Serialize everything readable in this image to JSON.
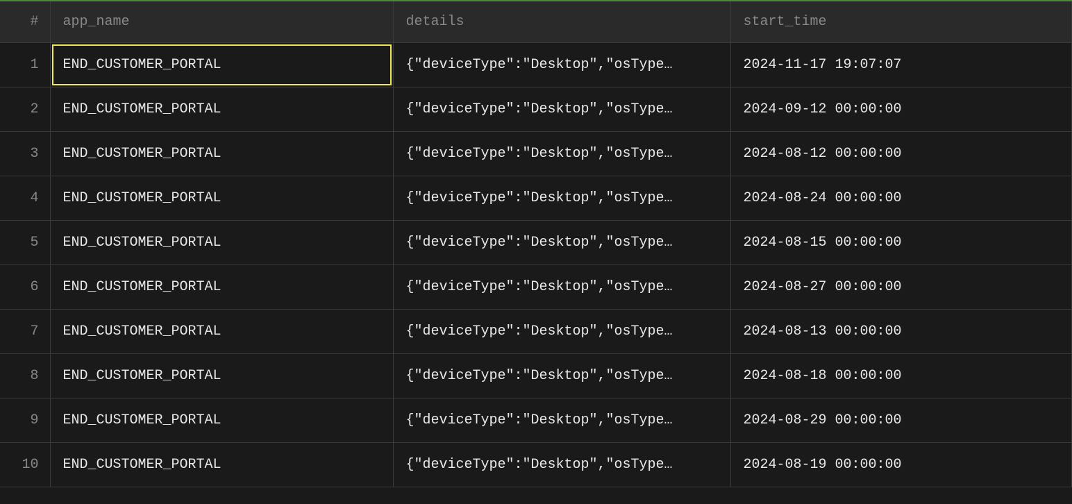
{
  "table": {
    "columns": {
      "index": "#",
      "app_name": "app_name",
      "details": "details",
      "start_time": "start_time"
    },
    "selected_cell": {
      "row": 0,
      "col": "app_name"
    },
    "rows": [
      {
        "index": "1",
        "app_name": "END_CUSTOMER_PORTAL",
        "details": "{\"deviceType\":\"Desktop\",\"osType…",
        "start_time": "2024-11-17 19:07:07"
      },
      {
        "index": "2",
        "app_name": "END_CUSTOMER_PORTAL",
        "details": "{\"deviceType\":\"Desktop\",\"osType…",
        "start_time": "2024-09-12 00:00:00"
      },
      {
        "index": "3",
        "app_name": "END_CUSTOMER_PORTAL",
        "details": "{\"deviceType\":\"Desktop\",\"osType…",
        "start_time": "2024-08-12 00:00:00"
      },
      {
        "index": "4",
        "app_name": "END_CUSTOMER_PORTAL",
        "details": "{\"deviceType\":\"Desktop\",\"osType…",
        "start_time": "2024-08-24 00:00:00"
      },
      {
        "index": "5",
        "app_name": "END_CUSTOMER_PORTAL",
        "details": "{\"deviceType\":\"Desktop\",\"osType…",
        "start_time": "2024-08-15 00:00:00"
      },
      {
        "index": "6",
        "app_name": "END_CUSTOMER_PORTAL",
        "details": "{\"deviceType\":\"Desktop\",\"osType…",
        "start_time": "2024-08-27 00:00:00"
      },
      {
        "index": "7",
        "app_name": "END_CUSTOMER_PORTAL",
        "details": "{\"deviceType\":\"Desktop\",\"osType…",
        "start_time": "2024-08-13 00:00:00"
      },
      {
        "index": "8",
        "app_name": "END_CUSTOMER_PORTAL",
        "details": "{\"deviceType\":\"Desktop\",\"osType…",
        "start_time": "2024-08-18 00:00:00"
      },
      {
        "index": "9",
        "app_name": "END_CUSTOMER_PORTAL",
        "details": "{\"deviceType\":\"Desktop\",\"osType…",
        "start_time": "2024-08-29 00:00:00"
      },
      {
        "index": "10",
        "app_name": "END_CUSTOMER_PORTAL",
        "details": "{\"deviceType\":\"Desktop\",\"osType…",
        "start_time": "2024-08-19 00:00:00"
      }
    ]
  }
}
